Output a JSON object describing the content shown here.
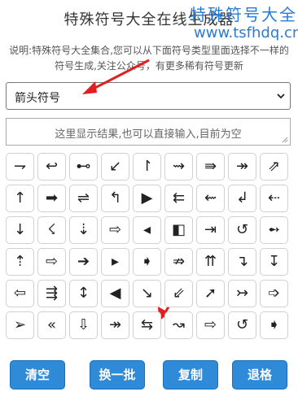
{
  "title": "特殊符号大全在线生成器",
  "watermark": {
    "title": "特殊符号大全",
    "url": "www.tsfhdq.cn"
  },
  "description": "说明:特殊符号大全集合,您可以从下面符号类型里面选择不一样的符号生成,关注公众号，有更多稀有符号更新",
  "category_select": {
    "value": "箭头符号"
  },
  "result_box": {
    "placeholder": "这里显示结果,也可以直接输入,目前为空"
  },
  "symbols": [
    [
      "⇁",
      "↩",
      "⊷",
      "↙",
      "↾",
      "⇝",
      "⇛",
      "↠",
      "⇗"
    ],
    [
      "↑",
      "➡",
      "⇌",
      "↰",
      "▶",
      "⇇",
      "⇜",
      "↲",
      "⇠"
    ],
    [
      "↓",
      "☇",
      "⇣",
      "⇨",
      "◂",
      "◧",
      "⇥",
      "↺",
      "➻"
    ],
    [
      "⇡",
      "⇨",
      "➔",
      "▸",
      "➧",
      "⇏",
      "⇈",
      "↴",
      "↧"
    ],
    [
      "⇦",
      "⇶",
      "↕",
      "◀",
      "↘",
      "⇙",
      "➚",
      "↣",
      "➩"
    ],
    [
      "➢",
      "«",
      "⇩",
      "↠",
      "⇆",
      "↝",
      "⇨",
      "↺",
      "➧"
    ]
  ],
  "buttons": {
    "clear": "清空",
    "refresh": "换一批",
    "copy": "复制",
    "backspace": "退格"
  },
  "colors": {
    "accent": "#2f8ad8",
    "annotation": "#e02020",
    "watermark": "#2a7bd2"
  }
}
